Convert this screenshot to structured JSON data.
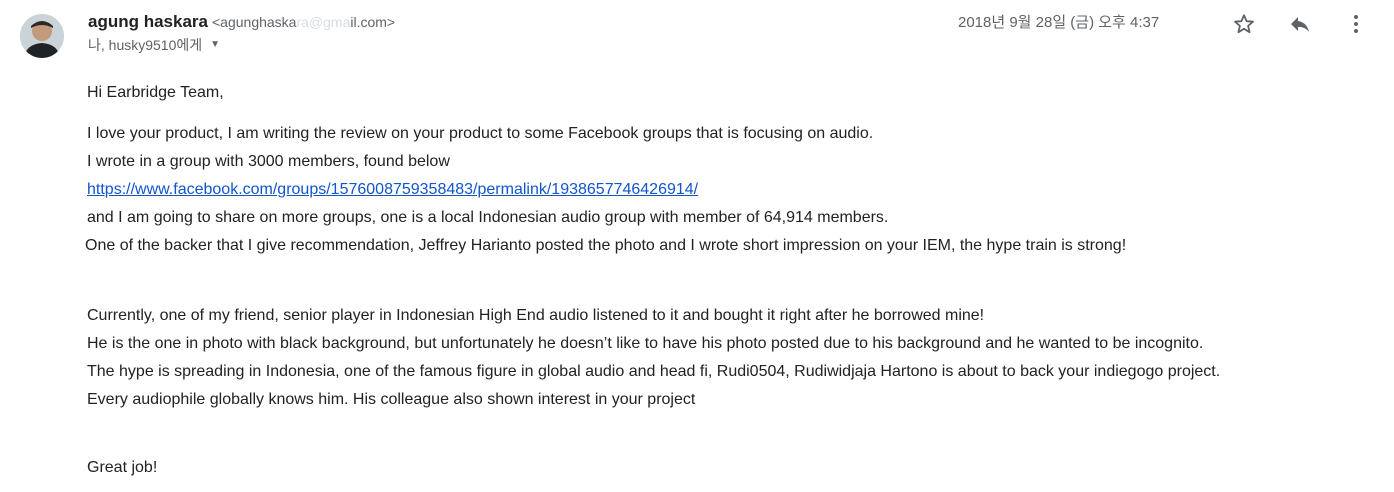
{
  "header": {
    "sender_name": "agung haskara",
    "sender_email_visible_start": "<agunghaska",
    "sender_email_redacted": "ra@gma",
    "sender_email_visible_end": "il.com>",
    "recipients": "나, husky9510에게",
    "date": "2018년 9월 28일 (금) 오후 4:37"
  },
  "icons": {
    "star": "star-outline-icon",
    "reply": "reply-arrow-icon",
    "more": "more-vertical-icon",
    "caret": "chevron-down-icon"
  },
  "body": {
    "greeting": "Hi Earbridge Team,",
    "para1": [
      "I love your product, I am writing the review on your product to some Facebook groups that is focusing on audio.",
      "I wrote in a group with 3000 members, found below",
      "https://www.facebook.com/groups/1576008759358483/permalink/1938657746426914/",
      "and I am going to share on more groups, one is a local Indonesian audio group with member of 64,914 members.",
      " One of the backer that I give recommendation, Jeffrey Harianto posted the photo and I wrote short impression on your IEM, the hype train is strong!"
    ],
    "para2": [
      "Currently, one of my friend, senior player in Indonesian High End audio listened to it and bought it right after he borrowed mine!",
      "He is the one in photo with black background, but unfortunately he doesn’t like to have his photo posted due to his background and he wanted to be incognito.",
      "The hype is spreading in Indonesia, one of the famous figure in global audio and head fi, Rudi0504, Rudiwidjaja Hartono is about to back your indiegogo project.",
      "Every audiophile globally knows him. His colleague also shown interest in your project"
    ],
    "closing": "Great job!"
  },
  "colors": {
    "link": "#1155cc",
    "text": "#222222",
    "secondary": "#5f6368",
    "icon": "#5f6368"
  }
}
